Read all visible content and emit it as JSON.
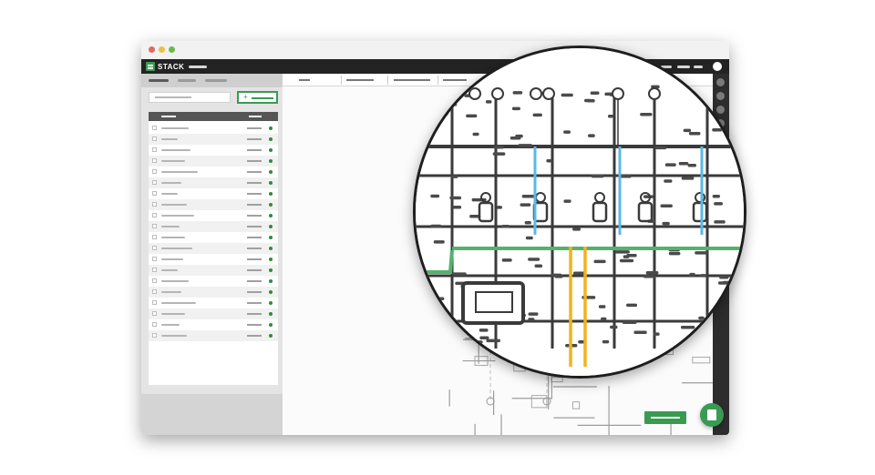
{
  "app": {
    "logo_text": "STACK"
  },
  "colors": {
    "brand_green": "#3a9a52",
    "status_green": "#2e8b3e",
    "pipe_blue": "#5bb8e6",
    "pipe_yellow": "#f0b41c",
    "pipe_green": "#52b36b"
  },
  "icons": {
    "logo": "stack-logo-icon",
    "fab": "document-icon",
    "add": "plus-icon"
  },
  "sidebar": {
    "add_button_symbol": "+",
    "list_rows": 20
  }
}
